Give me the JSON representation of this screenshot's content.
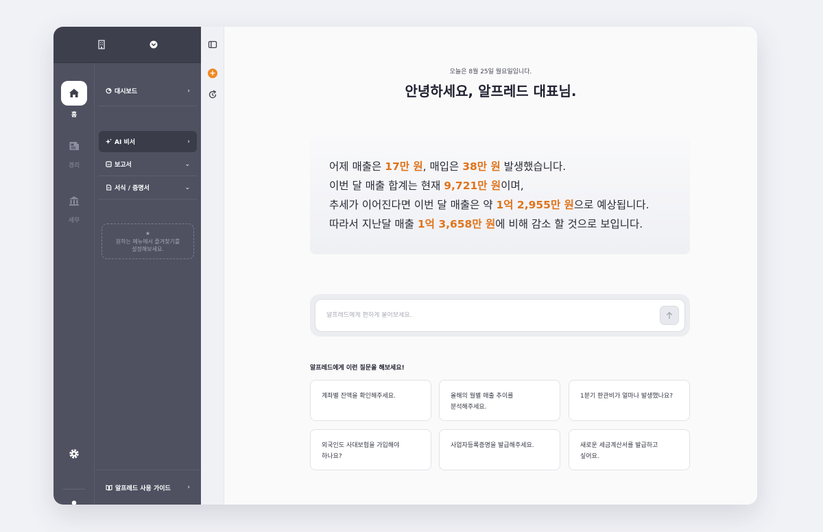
{
  "colors": {
    "accent": "#e0741c",
    "sidebar": "#4f5161",
    "sidebar_top": "#3d3f4c"
  },
  "topbar": {
    "icons": [
      "building-icon",
      "chevron-circle-icon"
    ]
  },
  "rail": {
    "items": [
      {
        "label": "홈",
        "icon": "home-icon",
        "active": true
      },
      {
        "label": "경리",
        "icon": "ledger-icon",
        "active": false
      },
      {
        "label": "세무",
        "icon": "bank-icon",
        "active": false
      }
    ],
    "settings_icon": "gear-icon",
    "profile_icon": "user-icon"
  },
  "menu": {
    "items": [
      {
        "label": "대시보드",
        "icon": "pie-icon",
        "chevron": "›"
      },
      {
        "label": "AI 비서",
        "icon": "sparkle-icon",
        "chevron": "›"
      },
      {
        "label": "보고서",
        "icon": "report-icon",
        "chevron": "⌄"
      },
      {
        "label": "서식 / 증명서",
        "icon": "document-icon",
        "chevron": "⌄"
      }
    ],
    "favorites_hint_line1": "원하는 메뉴에서 즐겨찾기를",
    "favorites_hint_line2": "설정해보세요.",
    "guide_label": "알프레드 사용 가이드",
    "guide_chevron": "›"
  },
  "main": {
    "date": "오늘은 8월 25일 월요일입니다.",
    "greeting": "안녕하세요, 알프레드 대표님.",
    "summary": {
      "l1_a": "어제 매출은 ",
      "l1_b": "17만 원",
      "l1_c": ", 매입은 ",
      "l1_d": "38만 원",
      "l1_e": " 발생했습니다.",
      "l2_a": "이번 달 매출 합계는 현재 ",
      "l2_b": "9,721만 원",
      "l2_c": "이며,",
      "l3_a": "추세가 이어진다면 이번 달 매출은 약 ",
      "l3_b": "1억 2,955만 원",
      "l3_c": "으로 예상됩니다.",
      "l4_a": "따라서 지난달 매출 ",
      "l4_b": "1억 3,658만 원",
      "l4_c": "에 비해 감소 할 것으로 보입니다."
    },
    "ask_placeholder": "알프레드에게 편하게 물어보세요.",
    "suggest_title": "알프레드에게 이런 질문을 해보세요!",
    "suggestions": [
      {
        "line1": "계좌별 잔액을 확인해주세요.",
        "line2": ""
      },
      {
        "line1": "올해의 월별 매출 추이를",
        "line2": "분석해주세요."
      },
      {
        "line1": "1분기 판관비가 얼마나 발생했나요?",
        "line2": ""
      },
      {
        "line1": "외국인도 사대보험을 가입해야",
        "line2": "하나요?"
      },
      {
        "line1": "사업자등록증명을 발급해주세요.",
        "line2": ""
      },
      {
        "line1": "새로운 세금계산서를 발급하고",
        "line2": "싶어요."
      }
    ]
  }
}
